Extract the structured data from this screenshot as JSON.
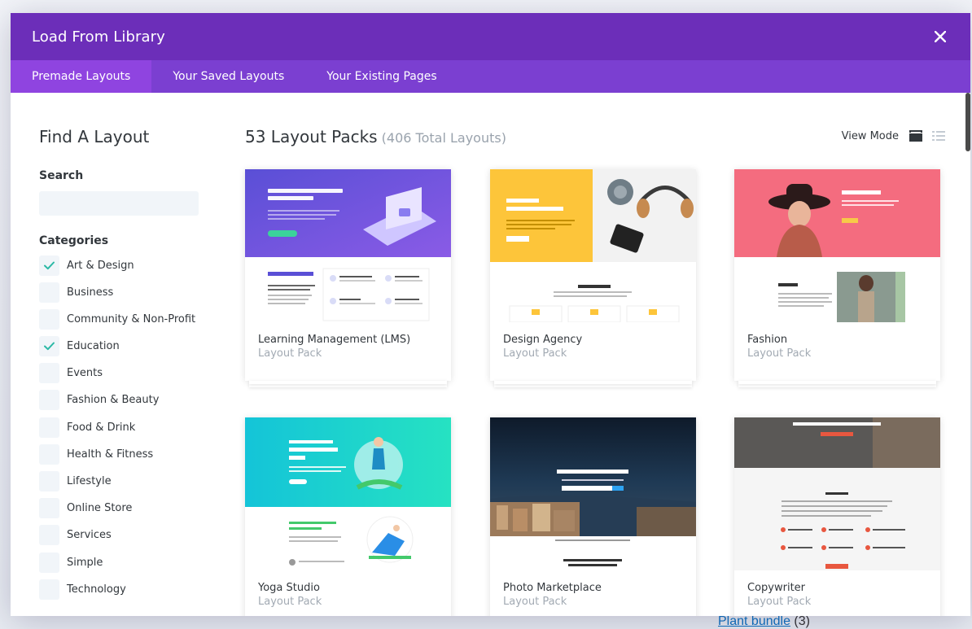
{
  "modal": {
    "title": "Load From Library",
    "close_icon": "close-icon"
  },
  "tabs": [
    {
      "label": "Premade Layouts",
      "active": true
    },
    {
      "label": "Your Saved Layouts",
      "active": false
    },
    {
      "label": "Your Existing Pages",
      "active": false
    }
  ],
  "sidebar": {
    "title": "Find A Layout",
    "search_label": "Search",
    "search_value": "",
    "categories_label": "Categories",
    "categories": [
      {
        "label": "Art & Design",
        "checked": true
      },
      {
        "label": "Business",
        "checked": false
      },
      {
        "label": "Community & Non-Profit",
        "checked": false
      },
      {
        "label": "Education",
        "checked": true
      },
      {
        "label": "Events",
        "checked": false
      },
      {
        "label": "Fashion & Beauty",
        "checked": false
      },
      {
        "label": "Food & Drink",
        "checked": false
      },
      {
        "label": "Health & Fitness",
        "checked": false
      },
      {
        "label": "Lifestyle",
        "checked": false
      },
      {
        "label": "Online Store",
        "checked": false
      },
      {
        "label": "Services",
        "checked": false
      },
      {
        "label": "Simple",
        "checked": false
      },
      {
        "label": "Technology",
        "checked": false
      }
    ]
  },
  "main": {
    "packs_title": "53 Layout Packs",
    "packs_total": "(406 Total Layouts)",
    "view_mode_label": "View Mode",
    "cards": [
      {
        "name": "Learning Management (LMS)",
        "sub": "Layout Pack",
        "thumb": {
          "hero_title": "Learn to Code Websites, Apps & Games",
          "section_title": "100's of Courses",
          "features": [
            "Web Development",
            "Javascript",
            "Python",
            "HTML & CSS"
          ]
        }
      },
      {
        "name": "Design Agency",
        "sub": "Layout Pack",
        "thumb": {
          "hero_title": "CREATIVE DESIGN AGENCY",
          "section_title": "WHAT WE DO"
        }
      },
      {
        "name": "Fashion",
        "sub": "Layout Pack",
        "thumb": {
          "hero_title": "High Fashion",
          "section_title": "About Us"
        }
      },
      {
        "name": "Yoga Studio",
        "sub": "Layout Pack",
        "thumb": {
          "hero_title": "Divi Yoga Studio Balance, Mind & Body",
          "section_title": "High Quality & Professional Yoga Club"
        }
      },
      {
        "name": "Photo Marketplace",
        "sub": "Layout Pack",
        "thumb": {
          "hero_title": "Photo Marketplace",
          "section_title": "A Leader in Quality Photography, Illustration & Video"
        }
      },
      {
        "name": "Copywriter",
        "sub": "Layout Pack",
        "thumb": {
          "hero_title": "A CONCEPTUAL COPYWRITER",
          "section_title": "ONE TRICK PONY"
        }
      }
    ]
  },
  "background_link": {
    "text": "Plant bundle",
    "count": "(3)"
  },
  "colors": {
    "header": "#6c2eb9",
    "tabs": "#7b3fd1",
    "active_tab": "#8f44e0",
    "checkmark": "#2cb9a6"
  }
}
